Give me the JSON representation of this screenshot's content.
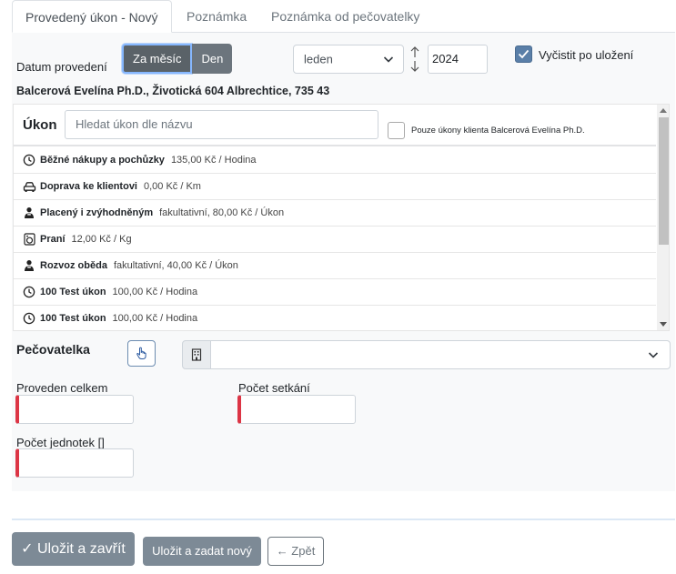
{
  "tabs": [
    {
      "label": "Provedený úkon - Nový",
      "active": true
    },
    {
      "label": "Poznámka",
      "active": false
    },
    {
      "label": "Poznámka od pečovatelky",
      "active": false
    }
  ],
  "form": {
    "date_label": "Datum provedení",
    "mode_buttons": {
      "month": "Za měsíc",
      "day": "Den"
    },
    "month_select": "leden",
    "year": "2024",
    "clear_after_save": {
      "label": "Vyčistit po uložení",
      "checked": true
    }
  },
  "client_line": "Balcerová Evelína Ph.D., Životická 604 Albrechtice, 735 43",
  "ukon": {
    "title": "Úkon",
    "search_placeholder": "Hledat úkon dle názvu",
    "only_client_label": "Pouze úkony klienta Balcerová Evelína Ph.D.",
    "only_client_checked": false,
    "items": [
      {
        "icon": "clock-icon",
        "name": "Běžné nákupy a pochůzky",
        "price": "135,00 Kč / Hodina"
      },
      {
        "icon": "car-icon",
        "name": "Doprava ke klientovi",
        "price": "0,00 Kč / Km"
      },
      {
        "icon": "person-icon",
        "name": "Placený i zvýhodněným",
        "price": "fakultativní, 80,00 Kč / Úkon"
      },
      {
        "icon": "washing-machine-icon",
        "name": "Praní",
        "price": "12,00 Kč / Kg"
      },
      {
        "icon": "person-icon",
        "name": "Rozvoz oběda",
        "price": "fakultativní, 40,00 Kč / Úkon"
      },
      {
        "icon": "clock-icon",
        "name": "100 Test úkon",
        "price": "100,00 Kč / Hodina"
      },
      {
        "icon": "clock-icon",
        "name": "100 Test úkon",
        "price": "100,00 Kč / Hodina"
      }
    ]
  },
  "pecovatelka": {
    "label": "Pečovatelka",
    "value": ""
  },
  "fields": {
    "proveden_celkem": {
      "label": "Proveden celkem",
      "value": ""
    },
    "pocet_setkani": {
      "label": "Počet setkání",
      "value": ""
    },
    "pocet_jednotek": {
      "label": "Počet jednotek []",
      "value": ""
    }
  },
  "actions": {
    "save_close": "✓ Uložit a zavřít",
    "save_new": "Uložit a zadat nový",
    "back": "← Zpět"
  },
  "colors": {
    "primary_muted": "#7d8a96",
    "required": "#dc3545",
    "checkbox_checked": "#5a7fa8"
  }
}
